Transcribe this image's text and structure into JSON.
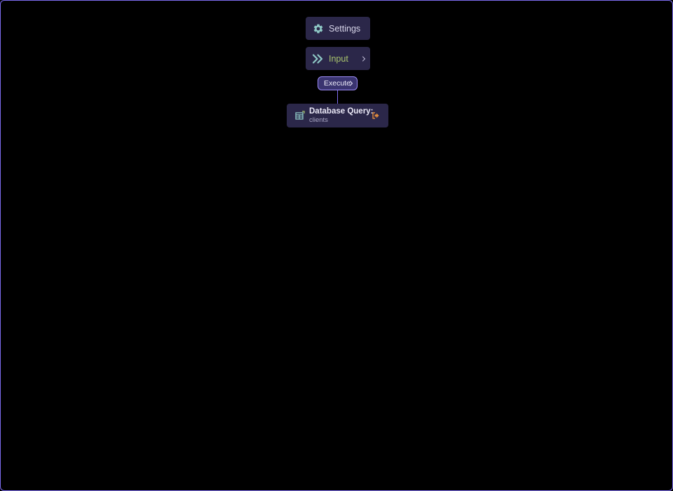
{
  "nodes": {
    "settings": {
      "label": "Settings",
      "icon": "gear-icon"
    },
    "input": {
      "label": "Input",
      "icon": "double-chevron-right-icon",
      "label_color": "#a9c46d"
    },
    "execute": {
      "label": "Execute"
    },
    "database_query": {
      "title": "Database Query:",
      "subtitle": "clients",
      "icon": "table-icon",
      "action_icon": "exit-icon"
    }
  },
  "colors": {
    "canvas_border": "#7d6cf0",
    "node_bg": "#2b2749",
    "icon_teal": "#8fc9c6",
    "exit_orange": "#e08a3c",
    "pill_border": "#9c8cf6"
  }
}
